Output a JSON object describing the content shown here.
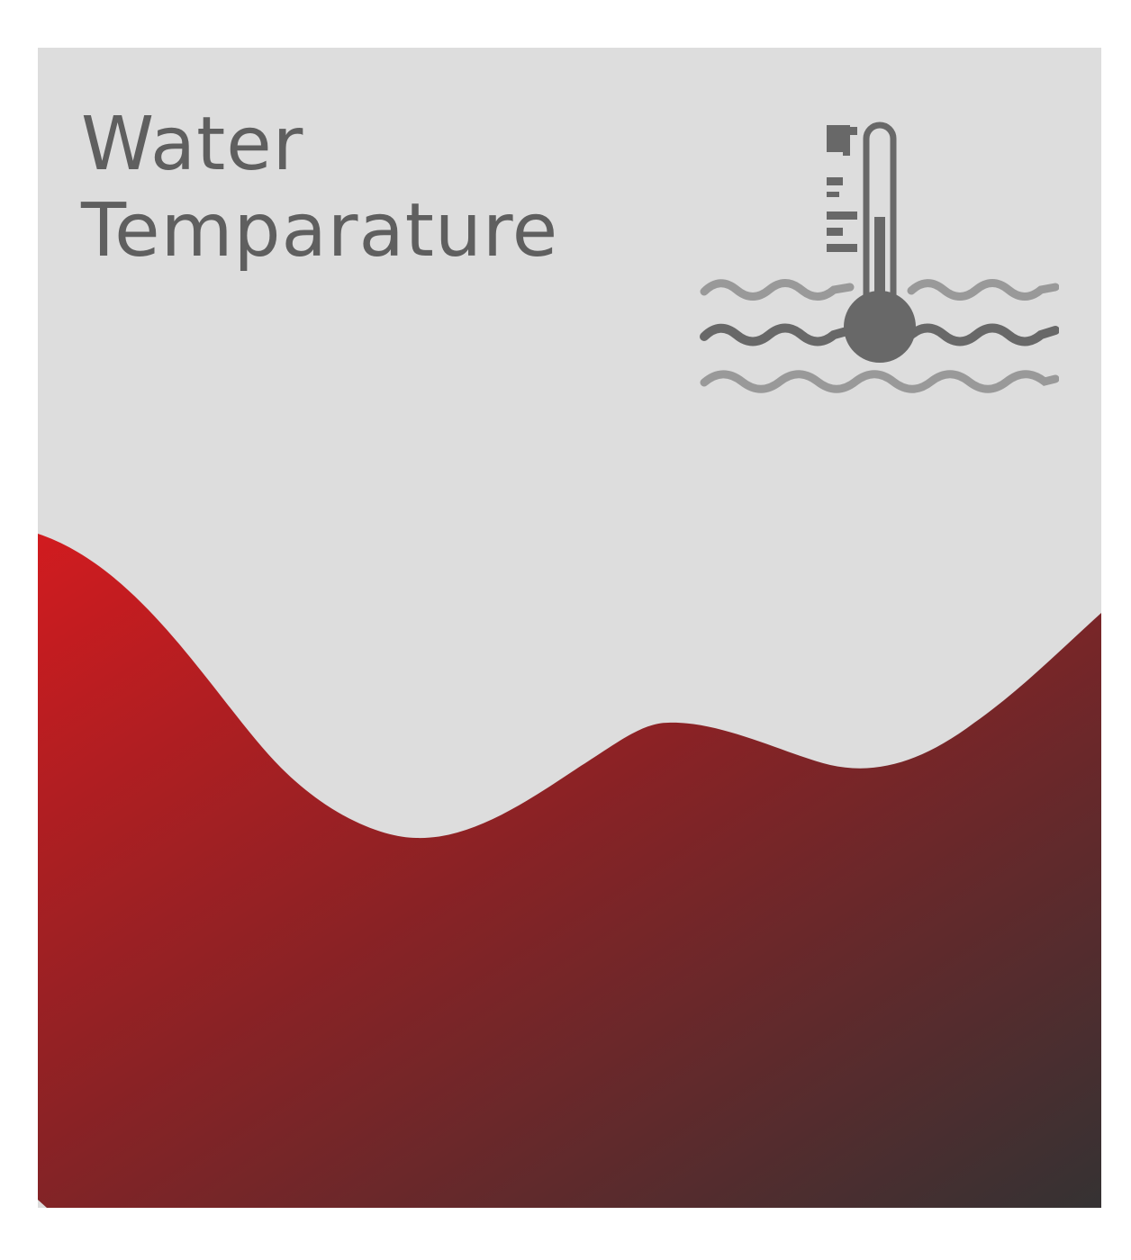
{
  "title": {
    "line1": "Water",
    "line2": "Temparature"
  },
  "icon": {
    "name": "water-temperature-icon",
    "color": "#686868",
    "light_color": "#999999"
  },
  "colors": {
    "background": "#dddddd",
    "text": "#5f5f5f",
    "wave_start": "#d11b1f",
    "wave_mid": "#8a2225",
    "wave_end": "#353233"
  }
}
